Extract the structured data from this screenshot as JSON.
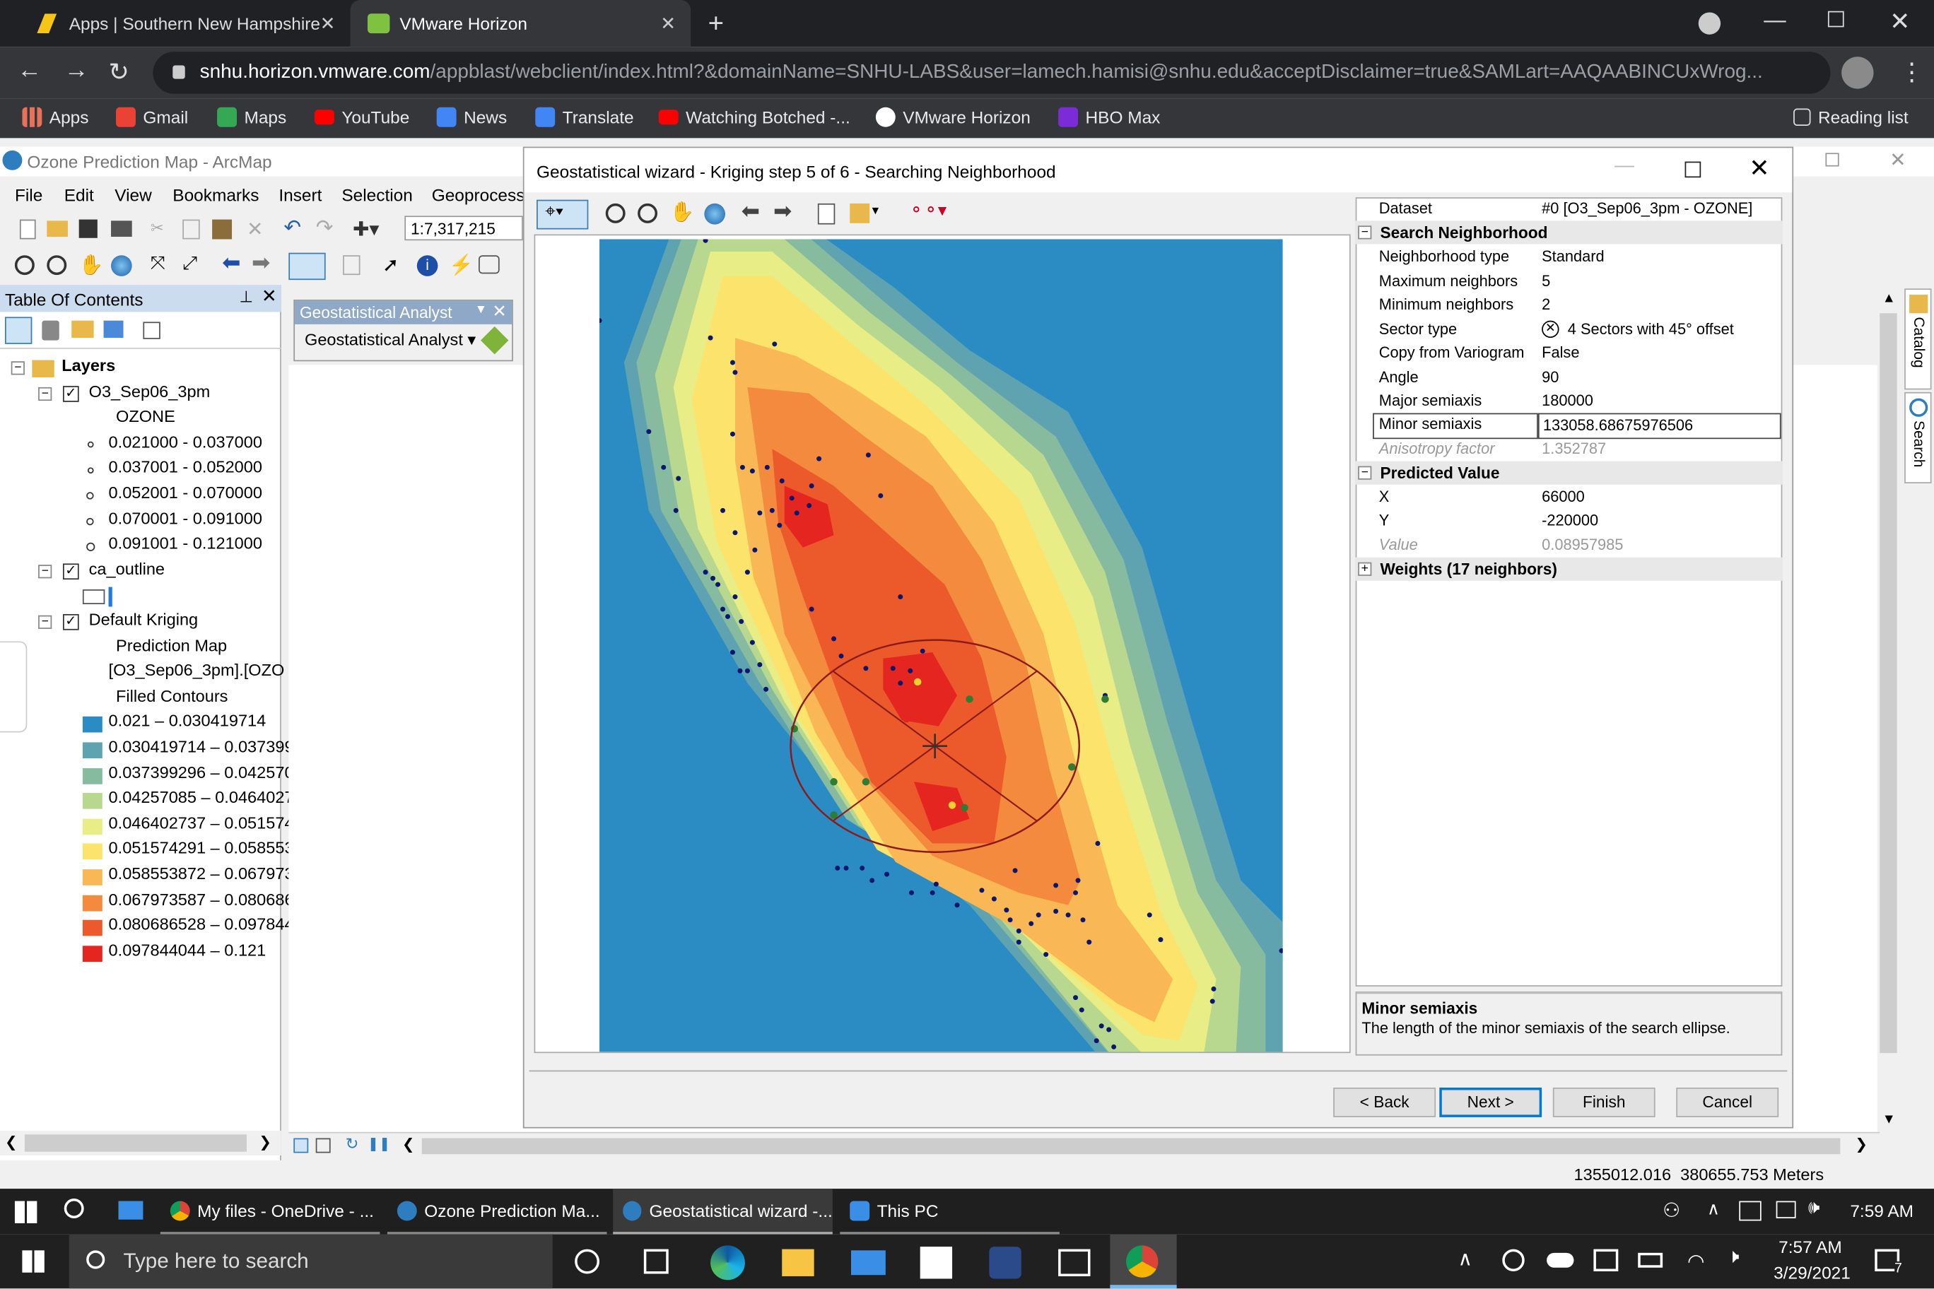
{
  "browser": {
    "tabs": [
      {
        "label": "Apps | Southern New Hampshire"
      },
      {
        "label": "VMware Horizon"
      }
    ],
    "url": "snhu.horizon.vmware.com/appblast/webclient/index.html?&domainName=SNHU-LABS&user=lamech.hamisi@snhu.edu&acceptDisclaimer=true&SAMLart=AAQAABINCUxWrog...",
    "url_host": "snhu.horizon.vmware.com",
    "url_path": "/appblast/webclient/index.html?&domainName=SNHU-LABS&user=lamech.hamisi@snhu.edu&acceptDisclaimer=true&SAMLart=AAQAABINCUxWrog...",
    "bookmarks": [
      "Apps",
      "Gmail",
      "Maps",
      "YouTube",
      "News",
      "Translate",
      "Watching Botched -...",
      "VMware Horizon",
      "HBO Max"
    ],
    "reading_list": "Reading list"
  },
  "arcmap": {
    "title": "Ozone Prediction Map - ArcMap",
    "menus": [
      "File",
      "Edit",
      "View",
      "Bookmarks",
      "Insert",
      "Selection",
      "Geoprocessi"
    ],
    "scale": "1:7,317,215",
    "toc_title": "Table Of Contents",
    "ga_toolbar_title": "Geostatistical Analyst",
    "ga_dropdown": "Geostatistical Analyst",
    "layers_label": "Layers",
    "layer1": {
      "name": "O3_Sep06_3pm",
      "field": "OZONE",
      "classes": [
        "0.021000 - 0.037000",
        "0.037001 - 0.052000",
        "0.052001 - 0.070000",
        "0.070001 - 0.091000",
        "0.091001 - 0.121000"
      ]
    },
    "layer2": {
      "name": "ca_outline"
    },
    "layer3": {
      "name": "Default Kriging",
      "line2": "Prediction Map",
      "line3": "[O3_Sep06_3pm].[OZO",
      "line4": "Filled Contours",
      "classes": [
        {
          "label": "0.021 – 0.030419714",
          "color": "#2b8cc4"
        },
        {
          "label": "0.030419714 – 0.037399",
          "color": "#5fa3b0"
        },
        {
          "label": "0.037399296 – 0.042570",
          "color": "#86bba0"
        },
        {
          "label": "0.04257085 – 0.0464027",
          "color": "#b9d88f"
        },
        {
          "label": "0.046402737 – 0.051574",
          "color": "#e8ed85"
        },
        {
          "label": "0.051574291 – 0.058553",
          "color": "#fce36b"
        },
        {
          "label": "0.058553872 – 0.067973",
          "color": "#f9b855"
        },
        {
          "label": "0.067973587 – 0.080686",
          "color": "#f48a3d"
        },
        {
          "label": "0.080686528 – 0.097844",
          "color": "#ec5a2c"
        },
        {
          "label": "0.097844044 – 0.121",
          "color": "#e52620"
        }
      ]
    },
    "status_coords": "1355012.016  380655.753 Meters",
    "side_tabs": [
      "Catalog",
      "Search"
    ]
  },
  "wizard": {
    "title": "Geostatistical wizard - Kriging step 5 of 6 - Searching Neighborhood",
    "props": {
      "dataset_label": "Dataset",
      "dataset_value": "#0 [O3_Sep06_3pm - OZONE]",
      "section_search": "Search Neighborhood",
      "neighborhood_type_label": "Neighborhood type",
      "neighborhood_type_value": "Standard",
      "max_label": "Maximum neighbors",
      "max_value": "5",
      "min_label": "Minimum neighbors",
      "min_value": "2",
      "sector_label": "Sector type",
      "sector_value": "4 Sectors with 45° offset",
      "copy_label": "Copy from Variogram",
      "copy_value": "False",
      "angle_label": "Angle",
      "angle_value": "90",
      "major_label": "Major semiaxis",
      "major_value": "180000",
      "minor_label": "Minor semiaxis",
      "minor_value": "133058.68675976506",
      "aniso_label": "Anisotropy factor",
      "aniso_value": "1.352787",
      "section_predicted": "Predicted Value",
      "x_label": "X",
      "x_value": "66000",
      "y_label": "Y",
      "y_value": "-220000",
      "value_label": "Value",
      "value_value": "0.08957985",
      "section_weights": "Weights (17 neighbors)"
    },
    "help_title": "Minor semiaxis",
    "help_text": "The length of the minor semiaxis of the search ellipse.",
    "buttons": {
      "back": "< Back",
      "next": "Next >",
      "finish": "Finish",
      "cancel": "Cancel"
    }
  },
  "taskbar": {
    "apps": [
      "My files - OneDrive - ...",
      "Ozone Prediction Ma...",
      "Geostatistical wizard -...",
      "This PC"
    ],
    "remote_time": "7:59 AM",
    "search_placeholder": "Type here to search",
    "time": "7:57 AM",
    "date": "3/29/2021",
    "notif_count": "7"
  }
}
